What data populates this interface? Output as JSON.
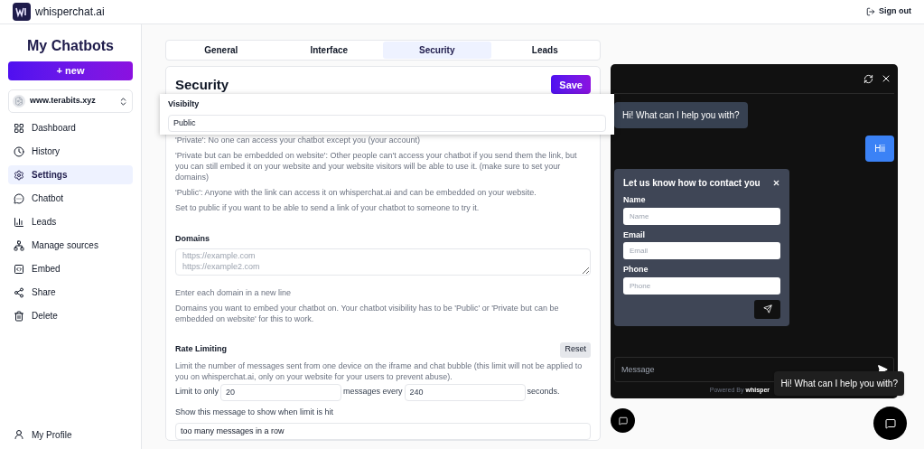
{
  "app": {
    "name": "whisperchat.ai",
    "sign_out": "Sign out"
  },
  "sidebar": {
    "title": "My Chatbots",
    "new_button": "+ new",
    "bot_selector": "www.terabits.xyz",
    "items": [
      {
        "label": "Dashboard",
        "selected": false
      },
      {
        "label": "History",
        "selected": false
      },
      {
        "label": "Settings",
        "selected": true
      },
      {
        "label": "Chatbot",
        "selected": false
      },
      {
        "label": "Leads",
        "selected": false
      },
      {
        "label": "Manage sources",
        "selected": false
      },
      {
        "label": "Embed",
        "selected": false
      },
      {
        "label": "Share",
        "selected": false
      },
      {
        "label": "Delete",
        "selected": false
      }
    ],
    "profile": "My Profile"
  },
  "tabs": [
    {
      "label": "General",
      "selected": false
    },
    {
      "label": "Interface",
      "selected": false
    },
    {
      "label": "Security",
      "selected": true
    },
    {
      "label": "Leads",
      "selected": false
    }
  ],
  "security": {
    "title": "Security",
    "save": "Save",
    "visibility": {
      "label": "Visibilty",
      "value": "Public"
    },
    "visibility_help": [
      "'Private': No one can access your chatbot except you (your account)",
      "'Private but can be embedded on website': Other people can't access your chatbot if you send them the link, but you can still embed it on your website and your website visitors will be able to use it. (make sure to set your domains)",
      "'Public': Anyone with the link can access it on whisperchat.ai and can be embedded on your website.",
      "Set to public if you want to be able to send a link of your chatbot to someone to try it."
    ],
    "domains": {
      "label": "Domains",
      "placeholder": "https://example.com\nhttps://example2.com",
      "hints": [
        "Enter each domain in a new line",
        "Domains you want to embed your chatbot on. Your chatbot visibility has to be 'Public' or 'Private but can be embedded on website' for this to work."
      ]
    },
    "rate_limiting": {
      "label": "Rate Limiting",
      "reset": "Reset",
      "description": "Limit the number of messages sent from one device on the iframe and chat bubble (this limit will not be applied to you on whisperchat.ai, only on your website for your users to prevent abuse).",
      "limit_prefix": "Limit to only",
      "limit_value": "20",
      "limit_middle": "messages every",
      "seconds_value": "240",
      "limit_suffix": "seconds.",
      "message_label": "Show this message to show when limit is hit",
      "message_value": "too many messages in a row"
    }
  },
  "chat": {
    "messages": [
      {
        "text": "Hi! What can I help you with?",
        "kind": "bot"
      },
      {
        "text": "Hii",
        "kind": "user"
      }
    ],
    "contact_form": {
      "title": "Let us know how to contact you",
      "fields": [
        {
          "label": "Name",
          "placeholder": "Name"
        },
        {
          "label": "Email",
          "placeholder": "Email"
        },
        {
          "label": "Phone",
          "placeholder": "Phone"
        }
      ]
    },
    "input_placeholder": "Message",
    "powered_by": "Powered By",
    "brand": "whisper",
    "tooltip": "Hi! What can I help you with?"
  }
}
